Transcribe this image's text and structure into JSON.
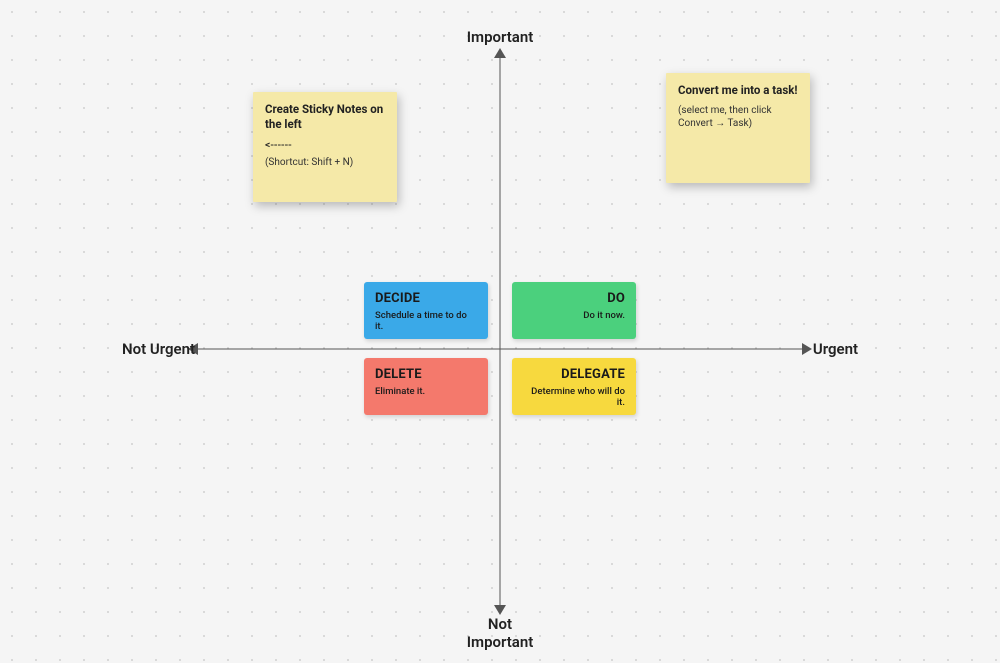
{
  "axes": {
    "top": "Important",
    "bottom": "Not\nImportant",
    "left": "Not Urgent",
    "right": "Urgent"
  },
  "stickies": {
    "left": {
      "title": "Create Sticky Notes on the left",
      "line": "<------",
      "sub": "(Shortcut: Shift + N)"
    },
    "right": {
      "title": "Convert me into a task!",
      "sub": "(select me, then click Convert → Task)"
    }
  },
  "quadrants": {
    "decide": {
      "title": "DECIDE",
      "sub": "Schedule a time to do it."
    },
    "do": {
      "title": "DO",
      "sub": "Do it now."
    },
    "delete": {
      "title": "DELETE",
      "sub": "Eliminate it."
    },
    "delegate": {
      "title": "DELEGATE",
      "sub": "Determine who will do it."
    }
  }
}
